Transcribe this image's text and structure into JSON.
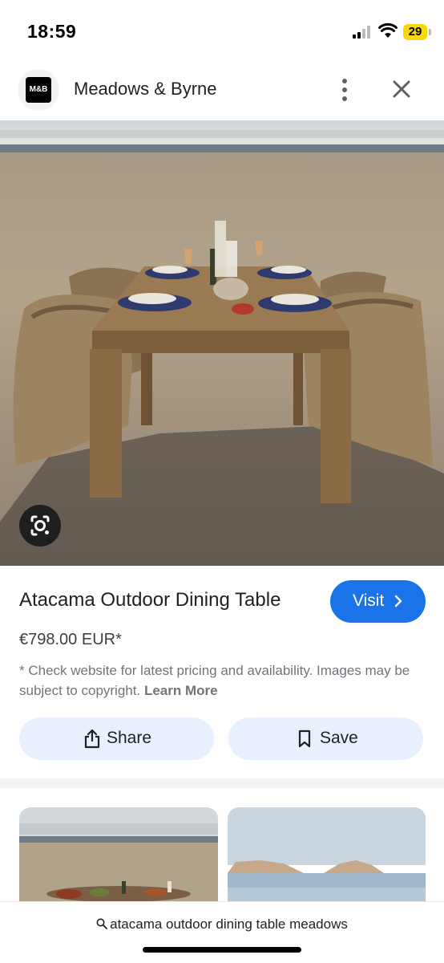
{
  "status_bar": {
    "time": "18:59",
    "battery": "29"
  },
  "header": {
    "logo_text": "M&B",
    "site_name": "Meadows & Byrne",
    "icons": [
      "more-vert-icon",
      "close-icon"
    ]
  },
  "product": {
    "title": "Atacama Outdoor Dining Table",
    "visit_label": "Visit",
    "price": "€798.00 EUR*",
    "disclaimer": "* Check website for latest pricing and availability. Images may be subject to copyright.",
    "learn_more": "Learn More"
  },
  "actions": {
    "share_label": "Share",
    "save_label": "Save"
  },
  "search": {
    "query": "atacama outdoor dining table meadows"
  },
  "colors": {
    "accent": "#1a73e8",
    "button_tint": "#e8f0fe",
    "battery": "#f5d90a"
  }
}
